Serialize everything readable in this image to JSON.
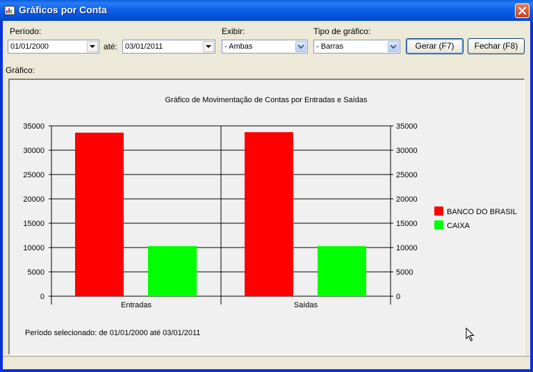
{
  "window": {
    "title": "Gráficos por Conta"
  },
  "form": {
    "periodo_label": "Período:",
    "periodo_from": "01/01/2000",
    "ate_label": "até:",
    "periodo_to": "03/01/2011",
    "exibir_label": "Exibir:",
    "exibir_value": "- Ambas",
    "tipo_label": "Tipo de gráfico:",
    "tipo_value": "- Barras",
    "gerar_label": "Gerar (F7)",
    "fechar_label": "Fechar (F8)",
    "grafico_label": "Gráfico:"
  },
  "footer": {
    "selected_period": "Período selecionado: de 01/01/2000 até 03/01/2011"
  },
  "colors": {
    "banco": "#ff0000",
    "caixa": "#00ff00"
  },
  "chart_data": {
    "type": "bar",
    "title": "Gráfico de Movimentação de Contas por Entradas e Saídas",
    "categories": [
      "Entradas",
      "Saídas"
    ],
    "series": [
      {
        "name": "BANCO DO BRASIL",
        "values": [
          33600,
          33700
        ]
      },
      {
        "name": "CAIXA",
        "values": [
          10300,
          10300
        ]
      }
    ],
    "ylim": [
      0,
      35000
    ],
    "yticks": [
      0,
      5000,
      10000,
      15000,
      20000,
      25000,
      30000,
      35000
    ],
    "grid": true,
    "legend": "right"
  }
}
